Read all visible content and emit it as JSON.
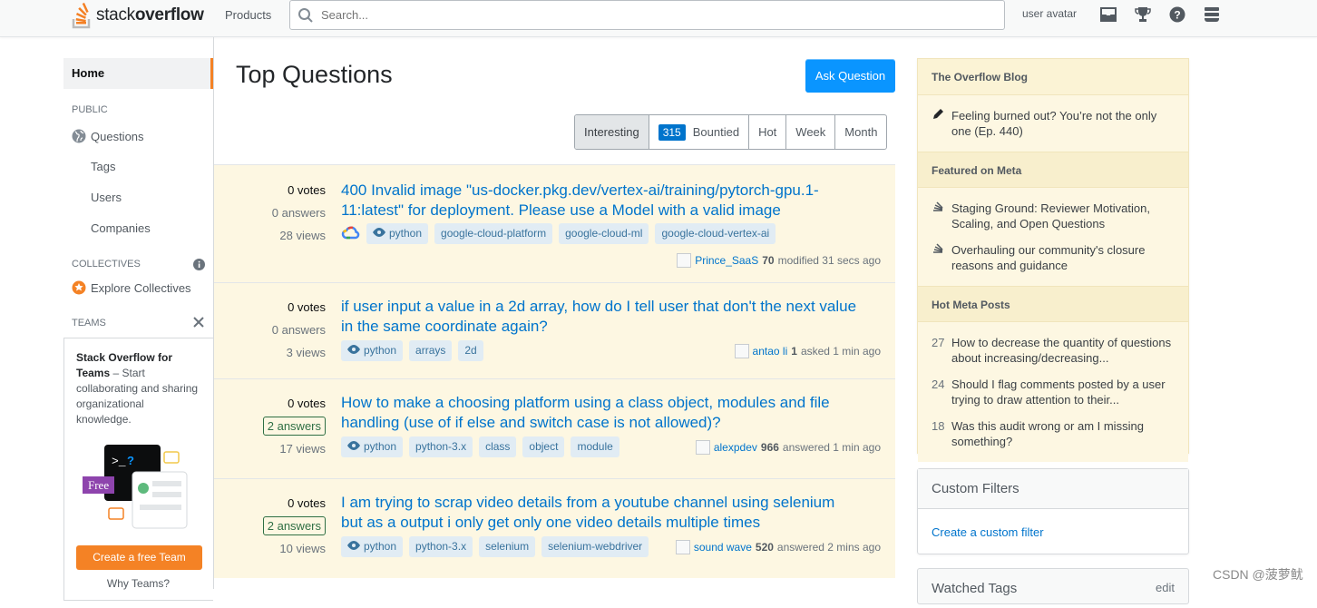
{
  "header": {
    "logo_text_light": "stack",
    "logo_text_bold": "overflow",
    "products": "Products",
    "search_placeholder": "Search...",
    "avatar_alt": "user avatar"
  },
  "leftnav": {
    "home": "Home",
    "public_label": "PUBLIC",
    "questions": "Questions",
    "tags": "Tags",
    "users": "Users",
    "companies": "Companies",
    "collectives_label": "COLLECTIVES",
    "explore_collectives": "Explore Collectives",
    "teams_label": "TEAMS",
    "teams_title": "Stack Overflow for Teams",
    "teams_text": "– Start collaborating and sharing organizational knowledge.",
    "free_badge": "Free",
    "create_team": "Create a free Team",
    "why_teams": "Why Teams?"
  },
  "main": {
    "title": "Top Questions",
    "ask_button": "Ask Question",
    "filters": {
      "interesting": "Interesting",
      "bounty_count": "315",
      "bountied": "Bountied",
      "hot": "Hot",
      "week": "Week",
      "month": "Month"
    },
    "questions": [
      {
        "votes": "0 votes",
        "answers": "0 answers",
        "views": "28 views",
        "title": "400 Invalid image \"us-docker.pkg.dev/vertex-ai/training/pytorch-gpu.1-11:latest\" for deployment. Please use a Model with a valid image",
        "tags": [
          "python",
          "google-cloud-platform",
          "google-cloud-ml",
          "google-cloud-vertex-ai"
        ],
        "user": "Prince_SaaS",
        "rep": "70",
        "action": "modified 31 secs ago"
      },
      {
        "votes": "0 votes",
        "answers": "0 answers",
        "views": "3 views",
        "title": "if user input a value in a 2d array, how do I tell user that don't the next value in the same coordinate again?",
        "tags": [
          "python",
          "arrays",
          "2d"
        ],
        "user": "antao li",
        "rep": "1",
        "action": "asked 1 min ago"
      },
      {
        "votes": "0 votes",
        "answers": "2 answers",
        "views": "17 views",
        "title": "How to make a choosing platform using a class object, modules and file handling (use of if else and switch case is not allowed)?",
        "tags": [
          "python",
          "python-3.x",
          "class",
          "object",
          "module"
        ],
        "user": "alexpdev",
        "rep": "966",
        "action": "answered 1 min ago"
      },
      {
        "votes": "0 votes",
        "answers": "2 answers",
        "views": "10 views",
        "title": "I am trying to scrap video details from a youtube channel using selenium but as a output i only get only one video details multiple times",
        "tags": [
          "python",
          "python-3.x",
          "selenium",
          "selenium-webdriver"
        ],
        "user": "sound wave",
        "rep": "520",
        "action": "answered 2 mins ago"
      }
    ]
  },
  "sidebar": {
    "blog_title": "The Overflow Blog",
    "blog_items": [
      "Feeling burned out? You’re not the only one (Ep. 440)"
    ],
    "meta_title": "Featured on Meta",
    "meta_items": [
      "Staging Ground: Reviewer Motivation, Scaling, and Open Questions",
      "Overhauling our community's closure reasons and guidance"
    ],
    "hot_title": "Hot Meta Posts",
    "hot_items": [
      {
        "num": "27",
        "text": "How to decrease the quantity of questions about increasing/decreasing..."
      },
      {
        "num": "24",
        "text": "Should I flag comments posted by a user trying to draw attention to their..."
      },
      {
        "num": "18",
        "text": "Was this audit wrong or am I missing something?"
      }
    ],
    "custom_filters_title": "Custom Filters",
    "custom_filters_link": "Create a custom filter",
    "watched_tags_title": "Watched Tags",
    "watched_tags_edit": "edit"
  },
  "watermark": "CSDN @菠萝鱿",
  "colors": {
    "accent_orange": "#f48225",
    "link_blue": "#0074cc",
    "ask_blue": "#0a95ff",
    "highlight_bg": "#fdf7e2"
  }
}
